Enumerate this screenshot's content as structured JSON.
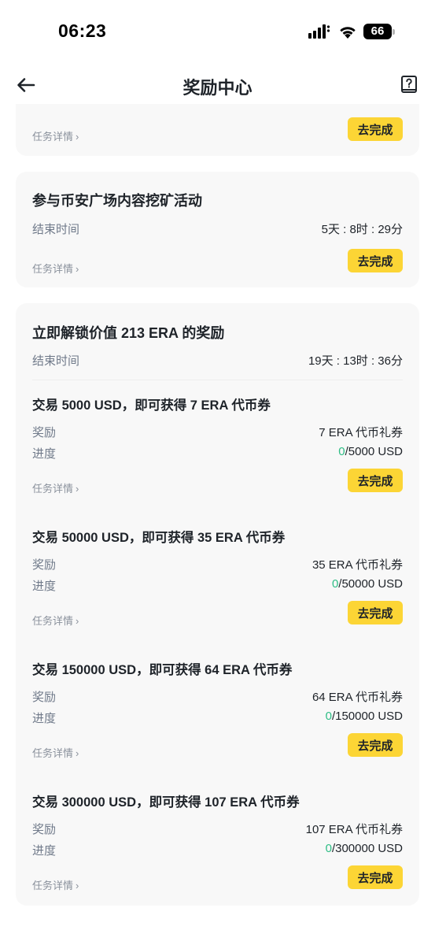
{
  "status_bar": {
    "time": "06:23",
    "battery": "66"
  },
  "header": {
    "title": "奖励中心"
  },
  "colors": {
    "accent": "#fcd535",
    "progress": "#2ebd85",
    "card": "#f8f8f8"
  },
  "card0": {
    "detail": "任务详情",
    "button": "去完成"
  },
  "card1": {
    "title": "参与币安广场内容挖矿活动",
    "end_label": "结束时间",
    "end_value": "5天 : 8时 : 29分",
    "detail": "任务详情",
    "button": "去完成"
  },
  "card2": {
    "title": "立即解锁价值 213 ERA 的奖励",
    "end_label": "结束时间",
    "end_value": "19天 : 13时 : 36分",
    "tasks": [
      {
        "title": "交易 5000 USD，即可获得 7 ERA 代币券",
        "reward_label": "奖励",
        "reward_value": "7 ERA 代币礼券",
        "progress_label": "进度",
        "progress_done": "0",
        "progress_total": "/5000 USD",
        "detail": "任务详情",
        "button": "去完成"
      },
      {
        "title": "交易 50000 USD，即可获得 35 ERA 代币券",
        "reward_label": "奖励",
        "reward_value": "35 ERA 代币礼券",
        "progress_label": "进度",
        "progress_done": "0",
        "progress_total": "/50000 USD",
        "detail": "任务详情",
        "button": "去完成"
      },
      {
        "title": "交易 150000 USD，即可获得 64 ERA 代币券",
        "reward_label": "奖励",
        "reward_value": "64 ERA 代币礼券",
        "progress_label": "进度",
        "progress_done": "0",
        "progress_total": "/150000 USD",
        "detail": "任务详情",
        "button": "去完成"
      },
      {
        "title": "交易 300000 USD，即可获得 107 ERA 代币券",
        "reward_label": "奖励",
        "reward_value": "107 ERA 代币礼券",
        "progress_label": "进度",
        "progress_done": "0",
        "progress_total": "/300000 USD",
        "detail": "任务详情",
        "button": "去完成"
      }
    ]
  }
}
